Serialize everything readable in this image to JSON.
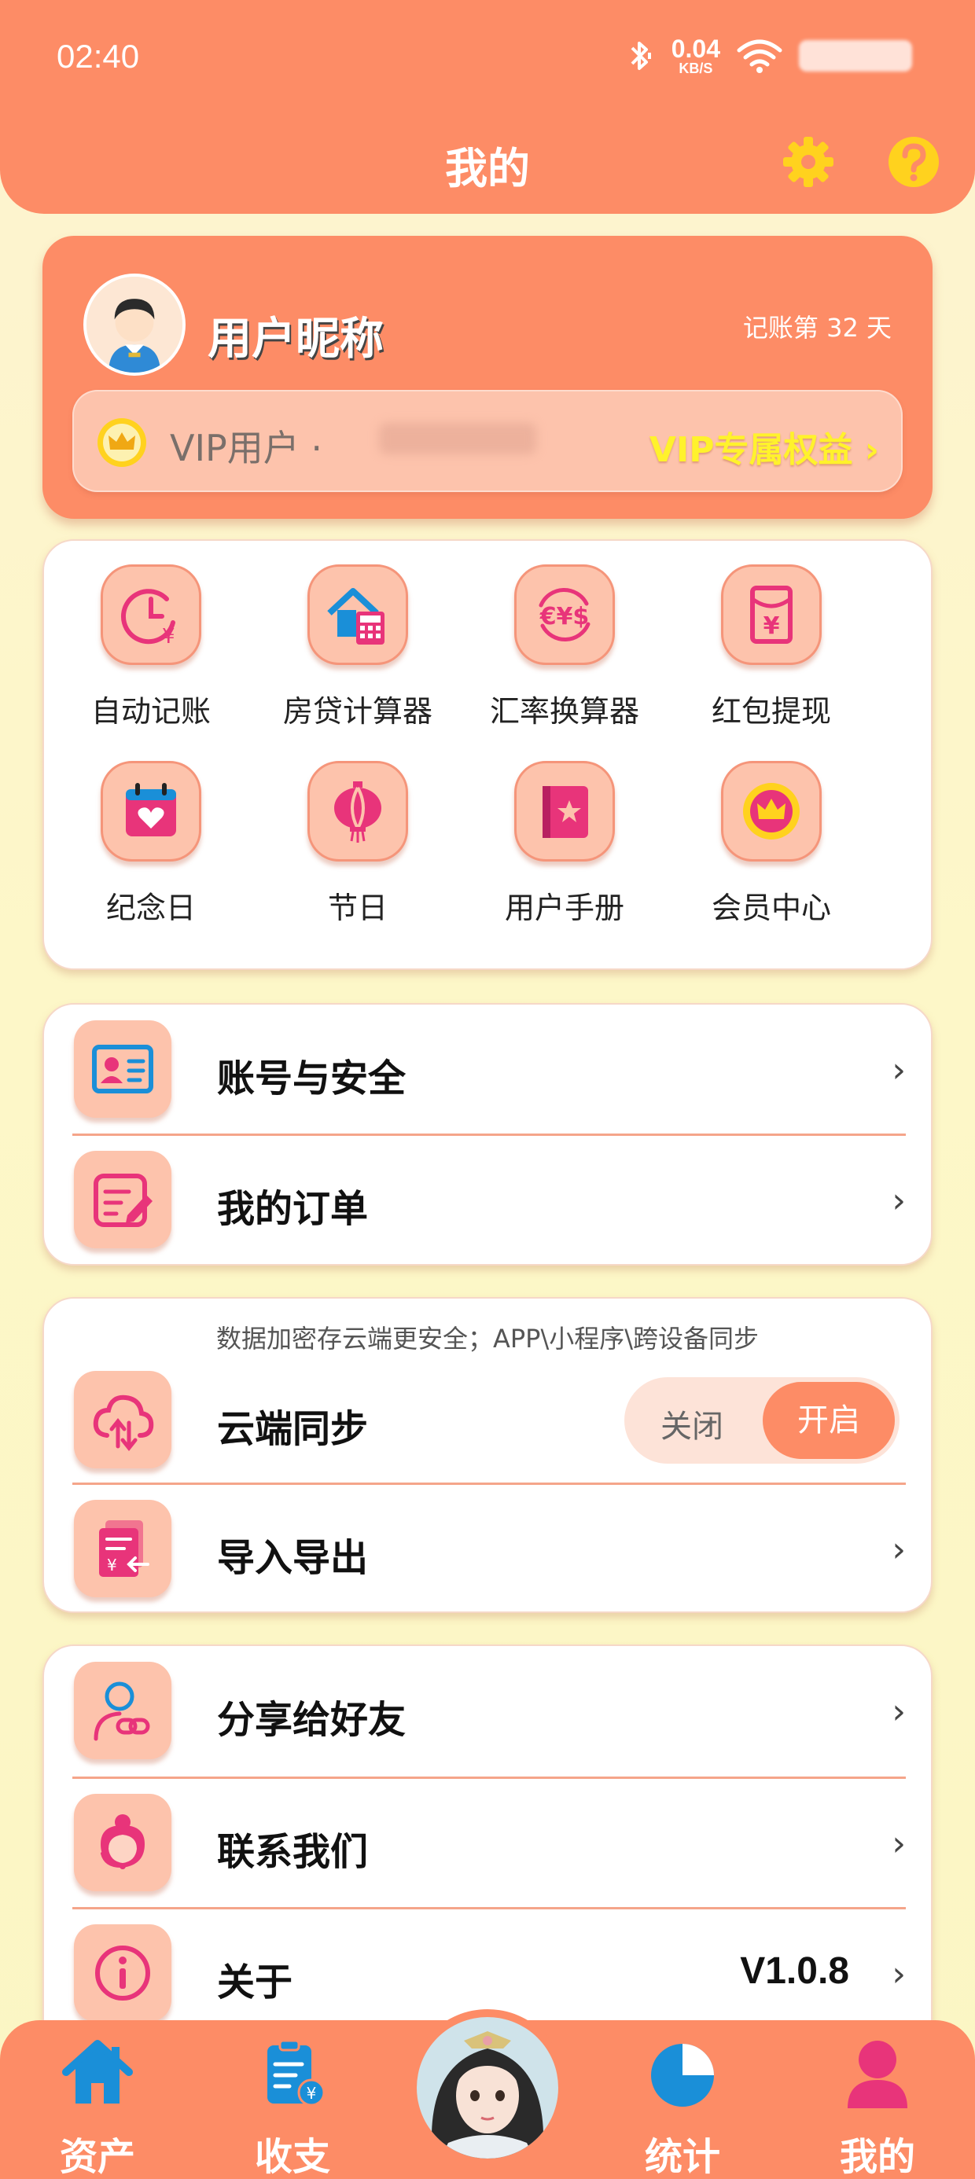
{
  "status_bar": {
    "time": "02:40",
    "speed_value": "0.04",
    "speed_unit": "KB/S"
  },
  "header": {
    "title": "我的"
  },
  "profile": {
    "nickname": "用户昵称",
    "days_text": "记账第 32 天",
    "vip_label": "VIP用户 · ",
    "vip_rights": "VIP专属权益 ›"
  },
  "tools": [
    {
      "label": "自动记账",
      "icon": "clock-yen-icon"
    },
    {
      "label": "房贷计算器",
      "icon": "house-calculator-icon"
    },
    {
      "label": "汇率换算器",
      "icon": "currency-exchange-icon"
    },
    {
      "label": "红包提现",
      "icon": "red-envelope-icon"
    },
    {
      "label": "纪念日",
      "icon": "calendar-heart-icon"
    },
    {
      "label": "节日",
      "icon": "lantern-icon"
    },
    {
      "label": "用户手册",
      "icon": "manual-book-icon"
    },
    {
      "label": "会员中心",
      "icon": "crown-badge-icon"
    }
  ],
  "account_section": {
    "items": [
      {
        "label": "账号与安全",
        "chevron": "›"
      },
      {
        "label": "我的订单",
        "chevron": "›"
      }
    ]
  },
  "data_section": {
    "hint": "数据加密存云端更安全；APP\\小程序\\跨设备同步",
    "sync_label": "云端同步",
    "toggle_off": "关闭",
    "toggle_on": "开启",
    "toggle_state": "on",
    "import_export": "导入导出",
    "chevron": "›"
  },
  "about_section": {
    "share": "分享给好友",
    "contact": "联系我们",
    "about": "关于",
    "version": "V1.0.8",
    "chevron": "›"
  },
  "bottom_nav": {
    "items": [
      {
        "label": "资产",
        "icon": "house-icon"
      },
      {
        "label": "收支",
        "icon": "clipboard-yen-icon"
      },
      {
        "label": "",
        "icon": "character-avatar"
      },
      {
        "label": "统计",
        "icon": "pie-chart-icon"
      },
      {
        "label": "我的",
        "icon": "person-icon"
      }
    ],
    "active": "我的"
  },
  "colors": {
    "primary": "#fd8c66",
    "icon_bg": "#fdc3ac",
    "vip_yellow": "#fff22c",
    "icon_pink": "#e8347a",
    "icon_blue": "#1a8fd8"
  }
}
